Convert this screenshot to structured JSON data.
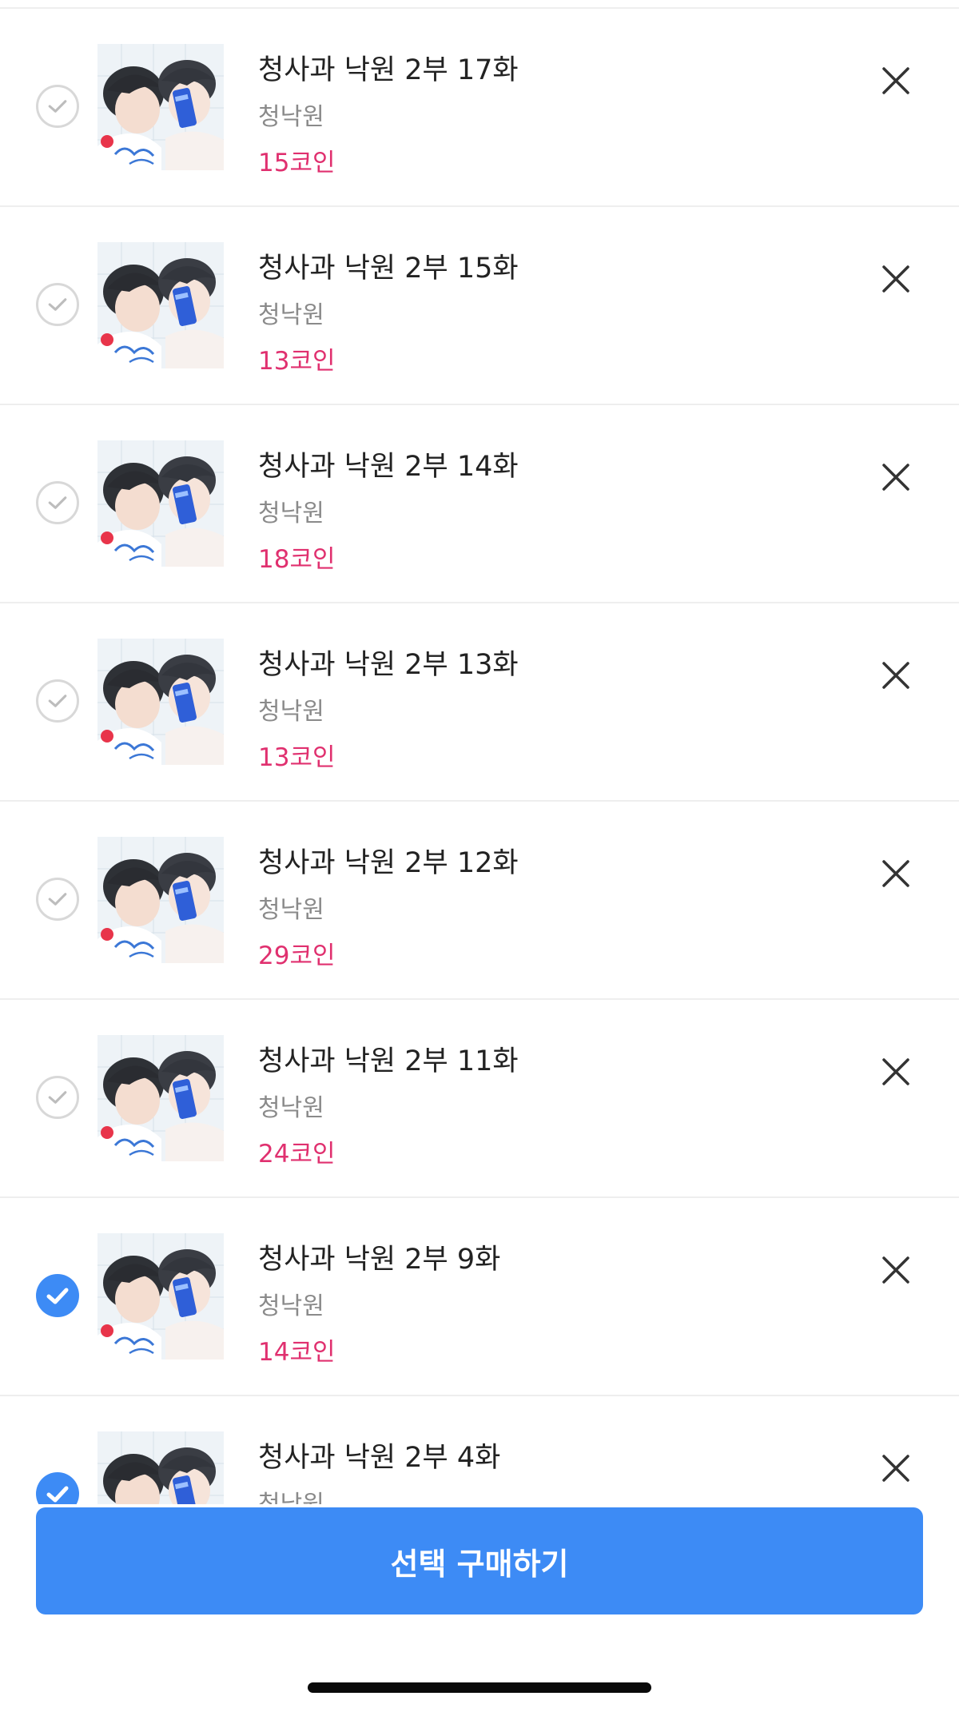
{
  "items": [
    {
      "title": "청사과 낙원 2부 17화",
      "author": "청낙원",
      "price": "15코인",
      "checked": false
    },
    {
      "title": "청사과 낙원 2부 15화",
      "author": "청낙원",
      "price": "13코인",
      "checked": false
    },
    {
      "title": "청사과 낙원 2부 14화",
      "author": "청낙원",
      "price": "18코인",
      "checked": false
    },
    {
      "title": "청사과 낙원 2부 13화",
      "author": "청낙원",
      "price": "13코인",
      "checked": false
    },
    {
      "title": "청사과 낙원 2부 12화",
      "author": "청낙원",
      "price": "29코인",
      "checked": false
    },
    {
      "title": "청사과 낙원 2부 11화",
      "author": "청낙원",
      "price": "24코인",
      "checked": false
    },
    {
      "title": "청사과 낙원 2부 9화",
      "author": "청낙원",
      "price": "14코인",
      "checked": true
    },
    {
      "title": "청사과 낙원 2부 4화",
      "author": "청낙원",
      "price": "",
      "checked": true
    }
  ],
  "buy_button": {
    "label": "선택 구매하기"
  },
  "colors": {
    "accent": "#3d8bf5",
    "price": "#e0306f",
    "divider": "#eeeeee"
  },
  "icons": {
    "check": "check-circle-icon",
    "remove": "close-icon",
    "thumbnail": "cover-thumbnail"
  }
}
